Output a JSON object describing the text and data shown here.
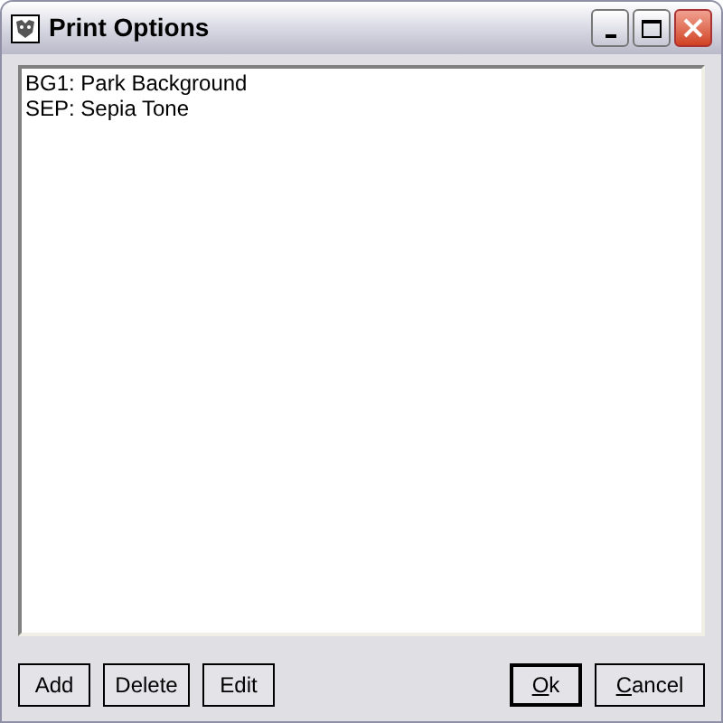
{
  "window": {
    "title": "Print Options"
  },
  "list": {
    "items": [
      {
        "label": "BG1: Park Background",
        "selected": false
      },
      {
        "label": "SEP: Sepia Tone",
        "selected": false
      }
    ]
  },
  "left_buttons": [
    {
      "label": "Add"
    },
    {
      "label": "Delete"
    },
    {
      "label": "Edit"
    }
  ],
  "right_buttons": [
    {
      "access_key": "O",
      "rest": "k",
      "default": true
    },
    {
      "access_key": "C",
      "rest": "ancel",
      "default": false
    }
  ]
}
